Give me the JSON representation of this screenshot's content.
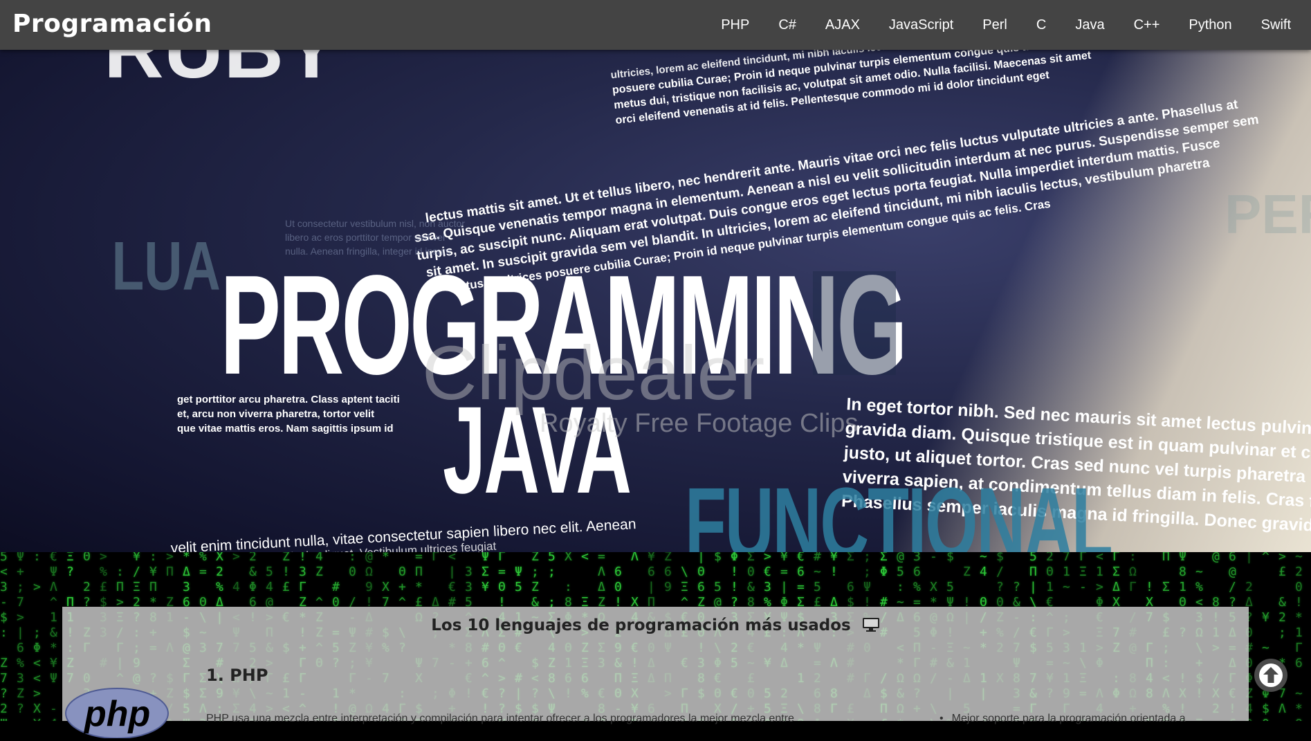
{
  "navbar": {
    "brand": "Programación",
    "items": [
      {
        "label": "PHP"
      },
      {
        "label": "C#"
      },
      {
        "label": "AJAX"
      },
      {
        "label": "JavaScript"
      },
      {
        "label": "Perl"
      },
      {
        "label": "C"
      },
      {
        "label": "Java"
      },
      {
        "label": "C++"
      },
      {
        "label": "Python"
      },
      {
        "label": "Swift"
      }
    ]
  },
  "hero": {
    "words": {
      "programming": "PROGRAMMING",
      "java": "JAVA",
      "lua": "LUA",
      "functional": "FUNCTIONAL",
      "perl": "PERL"
    },
    "watermark": "Clipdealer",
    "watermark_sub": "Royalty Free Footage Clips",
    "lorem_lines": [
      "posuere cubilia Curae; Proin id neque pulvinar turpis elementum congue quis ac felis. Cras",
      "metus dui, tristique non facilisis ac, volutpat sit amet odio. Nulla facilisi. Maecenas sit amet",
      "orci eleifend venenatis at id felis. Pellentesque commodo mi id dolor tincidunt eget",
      "lectus mattis sit amet. Ut et tellus libero, nec hendrerit ante. Mauris vitae orci nec felis luctus vulputate ultricies a ante. Phasellus at",
      "ssa. Quisque venenatis tempor magna in elementum. Aenean a nisl eu velit sollicitudin interdum at nec purus. Suspendisse semper sem",
      "turpis, ac suscipit nunc. Aliquam erat volutpat. Duis congue eros eget lectus porta feugiat. Nulla imperdiet interdum mattis. Fusce",
      "sit amet. In suscipit gravida sem vel blandit. In ultricies, lorem ac eleifend tincidunt, mi nibh iaculis lectus, vestibulum pharetra",
      "luctus et ultrices posuere cubilia Curae; Proin id neque pulvinar turpis elementum congue quis ac felis. Cras"
    ],
    "right_block": [
      "In eget tortor nibh. Sed nec mauris sit amet lectus pulvinar",
      "gravida diam. Quisque tristique est in quam pulvinar et co",
      "justo, ut aliquet tortor. Cras sed nunc vel turpis pharetra he",
      "viverra sapien, at condimentum tellus diam in felis. Cras fe",
      "Phasellus semper iaculis magna id fringilla. Donec gravida"
    ],
    "left_block": [
      "get porttitor arcu pharetra. Class aptent taciti",
      "et, arcu non viverra pharetra, tortor velit",
      "que vitae mattis eros. Nam sagittis ipsum id"
    ],
    "bottom_line": [
      "velit enim tincidunt nulla, vitae consectetur sapien libero nec elit. Aenean",
      "a sagittis vehicula aliquet. Vestibulum ultrices feugiat"
    ]
  },
  "content": {
    "heading": "Los 10 lenguajes de programación más usados",
    "first_language": {
      "title": "1. PHP",
      "logo_text": "php",
      "description": "PHP usa una mezcla entre interpretación y compilación para intentar ofrecer a los programadores la mejor mezcla entre",
      "bullet": "Mejor soporte para la programación orientada a"
    }
  },
  "colors": {
    "navbar": "#444444",
    "matrix_green": "#2fd13a",
    "panel": "#cdcdcd",
    "php_logo": "#8892bf"
  },
  "icons": {
    "heading_icon": "monitor-icon",
    "scroll_button": "arrow-up-circle-icon"
  }
}
